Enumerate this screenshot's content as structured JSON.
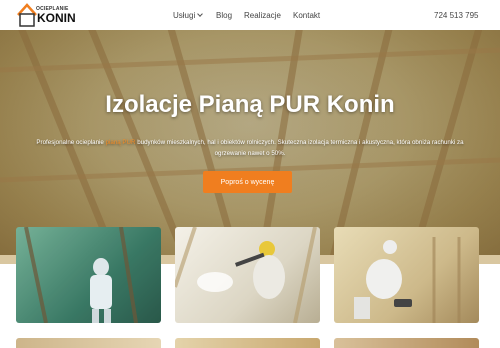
{
  "logo": {
    "line1": "OCIEPLANIE",
    "line2": "KONIN"
  },
  "nav": {
    "items": [
      {
        "label": "Usługi"
      },
      {
        "label": "Blog"
      },
      {
        "label": "Realizacje"
      },
      {
        "label": "Kontakt"
      }
    ],
    "phone": "724 513 795"
  },
  "hero": {
    "title": "Izolacje Pianą PUR Konin",
    "desc_pre": "Profesjonalne ocieplanie ",
    "desc_highlight": "pianą PUR",
    "desc_post": " budynków mieszkalnych, hal i obiektów rolniczych. Skuteczna izolacja termiczna i akustyczna, która obniża rachunki za ogrzewanie nawet o 50%.",
    "cta_label": "Poproś o wycenę"
  },
  "colors": {
    "accent": "#f07e1f",
    "hero_tint": "#d8c488"
  },
  "icons": {
    "dropdown": "chevron-down-icon",
    "logo": "house-logo-icon"
  }
}
